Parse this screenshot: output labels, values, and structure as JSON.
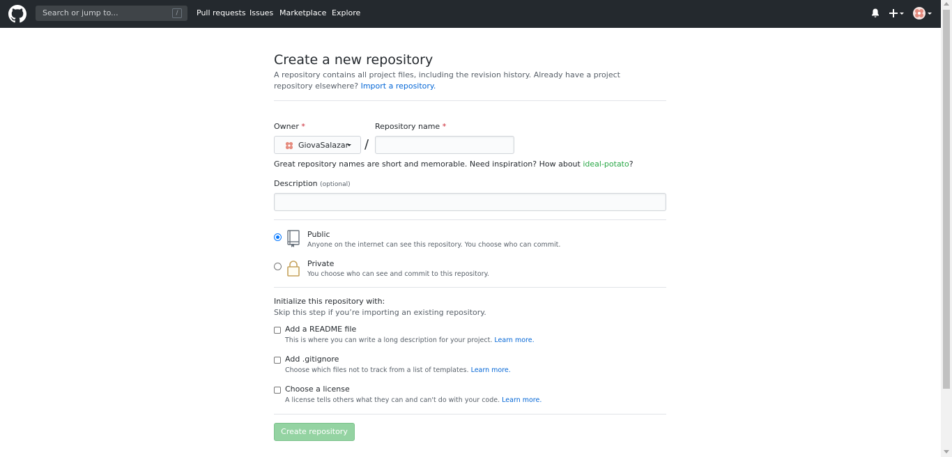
{
  "header": {
    "search_placeholder": "Search or jump to...",
    "search_shortcut": "/",
    "nav": [
      "Pull requests",
      "Issues",
      "Marketplace",
      "Explore"
    ]
  },
  "page": {
    "title": "Create a new repository",
    "subtitle_text": "A repository contains all project files, including the revision history. Already have a project repository elsewhere?",
    "import_link": "Import a repository."
  },
  "form": {
    "owner_label": "Owner",
    "required_mark": "*",
    "owner_value": "GiovaSalazar",
    "separator": "/",
    "repo_name_label": "Repository name",
    "repo_name_value": "",
    "hint_text": "Great repository names are short and memorable. Need inspiration? How about",
    "suggestion": "ideal-potato",
    "hint_end": "?",
    "description_label": "Description",
    "description_optional": "(optional)",
    "description_value": ""
  },
  "visibility": {
    "public_title": "Public",
    "public_desc": "Anyone on the internet can see this repository. You choose who can commit.",
    "public_selected": true,
    "private_title": "Private",
    "private_desc": "You choose who can see and commit to this repository.",
    "private_selected": false
  },
  "init": {
    "heading": "Initialize this repository with:",
    "subheading": "Skip this step if you’re importing an existing repository.",
    "readme_title": "Add a README file",
    "readme_desc": "This is where you can write a long description for your project.",
    "gitignore_title": "Add .gitignore",
    "gitignore_desc": "Choose which files not to track from a list of templates.",
    "license_title": "Choose a license",
    "license_desc": "A license tells others what they can and can't do with your code.",
    "learn_more": "Learn more."
  },
  "submit": {
    "label": "Create repository"
  },
  "colors": {
    "header_bg": "#24292e",
    "link": "#0366d6",
    "suggestion": "#28a745",
    "button_disabled": "#94d3a2"
  }
}
